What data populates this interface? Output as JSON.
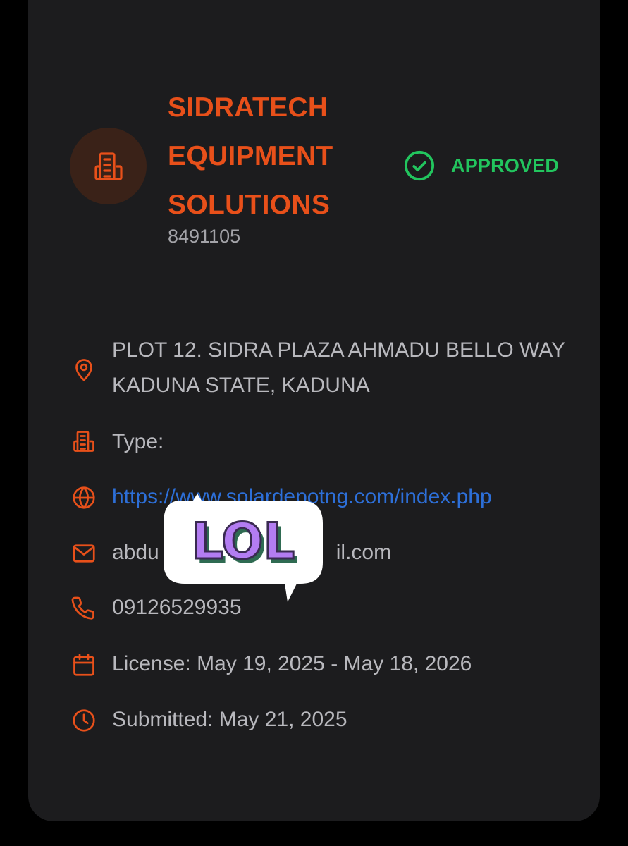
{
  "company": {
    "name": "SIDRATECH EQUIPMENT SOLUTIONS",
    "id": "8491105",
    "avatar_icon": "building-icon"
  },
  "status": {
    "label": "APPROVED",
    "icon": "check-circle-icon",
    "color": "#22c55e"
  },
  "details": {
    "address": "PLOT 12. SIDRA PLAZA AHMADU BELLO WAY KADUNA STATE, KADUNA",
    "type_label": "Type:",
    "website": "https://www.solardepotng.com/index.php",
    "email_visible_start": "abdu",
    "email_visible_end": "il.com",
    "phone": "09126529935",
    "license": "License: May 19, 2025 - May 18, 2026",
    "submitted": "Submitted: May 21, 2025"
  },
  "sticker": {
    "text": "LOL"
  },
  "colors": {
    "accent": "#e8501a",
    "approved": "#22c55e",
    "link": "#2d6fd8",
    "card_bg": "#1c1c1e"
  }
}
